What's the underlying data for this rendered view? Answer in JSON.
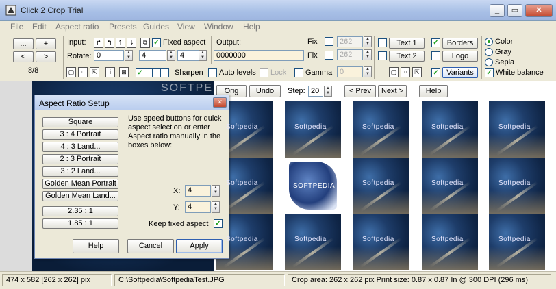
{
  "window": {
    "title": "Click 2 Crop Trial",
    "min": "_",
    "max": "▭",
    "close": "✕"
  },
  "menu": [
    "File",
    "Edit",
    "Aspect ratio",
    "Presets",
    "Guides",
    "View",
    "Window",
    "Help"
  ],
  "nav": {
    "btn_dots": "...",
    "btn_plus": "+",
    "btn_prev": "<",
    "btn_next": ">",
    "counter": "8/8"
  },
  "input": {
    "label": "Input:",
    "rotate_label": "Rotate:",
    "rotate_value": "0",
    "fixed_aspect_label": "Fixed aspect",
    "aspect_w": "4",
    "aspect_h": "4"
  },
  "output": {
    "label": "Output:",
    "value": "0000000",
    "fix1": "Fix",
    "fix2": "Fix",
    "fix1_value": "262",
    "fix2_value": "262"
  },
  "texts": {
    "text1": "Text 1",
    "text2": "Text 2"
  },
  "options": {
    "borders": "Borders",
    "logo": "Logo",
    "variants": "Variants",
    "white_balance": "White balance"
  },
  "color_modes": {
    "color": "Color",
    "gray": "Gray",
    "sepia": "Sepia"
  },
  "filters": {
    "sharpen": "Sharpen",
    "auto_levels": "Auto levels",
    "lock": "Lock",
    "gamma": "Gamma",
    "gamma_value": "0"
  },
  "icons_row": {
    "icon_a": "▢",
    "icon_b": "⌗",
    "icon_c": "⇱",
    "icon_d": "i",
    "icon_e": "⊞"
  },
  "toolbar2": {
    "orig": "Orig",
    "undo": "Undo",
    "step_label": "Step:",
    "step_value": "20",
    "prev": "< Prev",
    "next": "Next >",
    "help": "Help"
  },
  "watermark": "SOFTPEDIA",
  "thumb_watermark": "Softpedia",
  "selected_thumb_label": "SOFTPEDIA",
  "dialog": {
    "title": "Aspect Ratio Setup",
    "close": "✕",
    "buttons": [
      "Square",
      "3 : 4 Portrait",
      "4 : 3 Land...",
      "2 : 3 Portrait",
      "3 : 2 Land...",
      "Golden Mean Portrait",
      "Golden Mean Land...",
      "2.35 : 1",
      "1.85 : 1"
    ],
    "description": "Use speed buttons for quick aspect selection or enter Aspect ratio manually in the boxes below:",
    "x_label": "X:",
    "x_value": "4",
    "y_label": "Y:",
    "y_value": "4",
    "keep_fixed_label": "Keep fixed aspect",
    "help": "Help",
    "cancel": "Cancel",
    "apply": "Apply"
  },
  "status": {
    "size": "474 x 582  [262 x 262] pix",
    "path": "C:\\Softpedia\\SoftpediaTest.JPG",
    "crop": "Crop area: 262 x 262 pix  Print size: 0.87 x 0.87 In @ 300 DPI  (296 ms)"
  }
}
